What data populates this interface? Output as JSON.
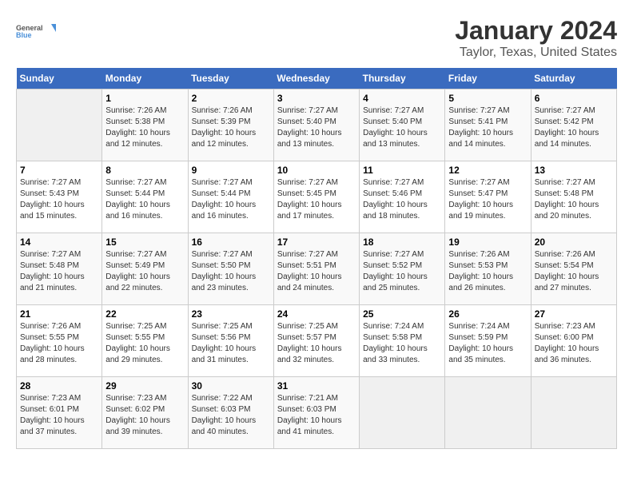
{
  "logo": {
    "text_general": "General",
    "text_blue": "Blue"
  },
  "title": "January 2024",
  "subtitle": "Taylor, Texas, United States",
  "header_color": "#3a6bbf",
  "days_of_week": [
    "Sunday",
    "Monday",
    "Tuesday",
    "Wednesday",
    "Thursday",
    "Friday",
    "Saturday"
  ],
  "weeks": [
    [
      {
        "day": "",
        "info": ""
      },
      {
        "day": "1",
        "info": "Sunrise: 7:26 AM\nSunset: 5:38 PM\nDaylight: 10 hours\nand 12 minutes."
      },
      {
        "day": "2",
        "info": "Sunrise: 7:26 AM\nSunset: 5:39 PM\nDaylight: 10 hours\nand 12 minutes."
      },
      {
        "day": "3",
        "info": "Sunrise: 7:27 AM\nSunset: 5:40 PM\nDaylight: 10 hours\nand 13 minutes."
      },
      {
        "day": "4",
        "info": "Sunrise: 7:27 AM\nSunset: 5:40 PM\nDaylight: 10 hours\nand 13 minutes."
      },
      {
        "day": "5",
        "info": "Sunrise: 7:27 AM\nSunset: 5:41 PM\nDaylight: 10 hours\nand 14 minutes."
      },
      {
        "day": "6",
        "info": "Sunrise: 7:27 AM\nSunset: 5:42 PM\nDaylight: 10 hours\nand 14 minutes."
      }
    ],
    [
      {
        "day": "7",
        "info": "Sunrise: 7:27 AM\nSunset: 5:43 PM\nDaylight: 10 hours\nand 15 minutes."
      },
      {
        "day": "8",
        "info": "Sunrise: 7:27 AM\nSunset: 5:44 PM\nDaylight: 10 hours\nand 16 minutes."
      },
      {
        "day": "9",
        "info": "Sunrise: 7:27 AM\nSunset: 5:44 PM\nDaylight: 10 hours\nand 16 minutes."
      },
      {
        "day": "10",
        "info": "Sunrise: 7:27 AM\nSunset: 5:45 PM\nDaylight: 10 hours\nand 17 minutes."
      },
      {
        "day": "11",
        "info": "Sunrise: 7:27 AM\nSunset: 5:46 PM\nDaylight: 10 hours\nand 18 minutes."
      },
      {
        "day": "12",
        "info": "Sunrise: 7:27 AM\nSunset: 5:47 PM\nDaylight: 10 hours\nand 19 minutes."
      },
      {
        "day": "13",
        "info": "Sunrise: 7:27 AM\nSunset: 5:48 PM\nDaylight: 10 hours\nand 20 minutes."
      }
    ],
    [
      {
        "day": "14",
        "info": "Sunrise: 7:27 AM\nSunset: 5:48 PM\nDaylight: 10 hours\nand 21 minutes."
      },
      {
        "day": "15",
        "info": "Sunrise: 7:27 AM\nSunset: 5:49 PM\nDaylight: 10 hours\nand 22 minutes."
      },
      {
        "day": "16",
        "info": "Sunrise: 7:27 AM\nSunset: 5:50 PM\nDaylight: 10 hours\nand 23 minutes."
      },
      {
        "day": "17",
        "info": "Sunrise: 7:27 AM\nSunset: 5:51 PM\nDaylight: 10 hours\nand 24 minutes."
      },
      {
        "day": "18",
        "info": "Sunrise: 7:27 AM\nSunset: 5:52 PM\nDaylight: 10 hours\nand 25 minutes."
      },
      {
        "day": "19",
        "info": "Sunrise: 7:26 AM\nSunset: 5:53 PM\nDaylight: 10 hours\nand 26 minutes."
      },
      {
        "day": "20",
        "info": "Sunrise: 7:26 AM\nSunset: 5:54 PM\nDaylight: 10 hours\nand 27 minutes."
      }
    ],
    [
      {
        "day": "21",
        "info": "Sunrise: 7:26 AM\nSunset: 5:55 PM\nDaylight: 10 hours\nand 28 minutes."
      },
      {
        "day": "22",
        "info": "Sunrise: 7:25 AM\nSunset: 5:55 PM\nDaylight: 10 hours\nand 29 minutes."
      },
      {
        "day": "23",
        "info": "Sunrise: 7:25 AM\nSunset: 5:56 PM\nDaylight: 10 hours\nand 31 minutes."
      },
      {
        "day": "24",
        "info": "Sunrise: 7:25 AM\nSunset: 5:57 PM\nDaylight: 10 hours\nand 32 minutes."
      },
      {
        "day": "25",
        "info": "Sunrise: 7:24 AM\nSunset: 5:58 PM\nDaylight: 10 hours\nand 33 minutes."
      },
      {
        "day": "26",
        "info": "Sunrise: 7:24 AM\nSunset: 5:59 PM\nDaylight: 10 hours\nand 35 minutes."
      },
      {
        "day": "27",
        "info": "Sunrise: 7:23 AM\nSunset: 6:00 PM\nDaylight: 10 hours\nand 36 minutes."
      }
    ],
    [
      {
        "day": "28",
        "info": "Sunrise: 7:23 AM\nSunset: 6:01 PM\nDaylight: 10 hours\nand 37 minutes."
      },
      {
        "day": "29",
        "info": "Sunrise: 7:23 AM\nSunset: 6:02 PM\nDaylight: 10 hours\nand 39 minutes."
      },
      {
        "day": "30",
        "info": "Sunrise: 7:22 AM\nSunset: 6:03 PM\nDaylight: 10 hours\nand 40 minutes."
      },
      {
        "day": "31",
        "info": "Sunrise: 7:21 AM\nSunset: 6:03 PM\nDaylight: 10 hours\nand 41 minutes."
      },
      {
        "day": "",
        "info": ""
      },
      {
        "day": "",
        "info": ""
      },
      {
        "day": "",
        "info": ""
      }
    ]
  ]
}
